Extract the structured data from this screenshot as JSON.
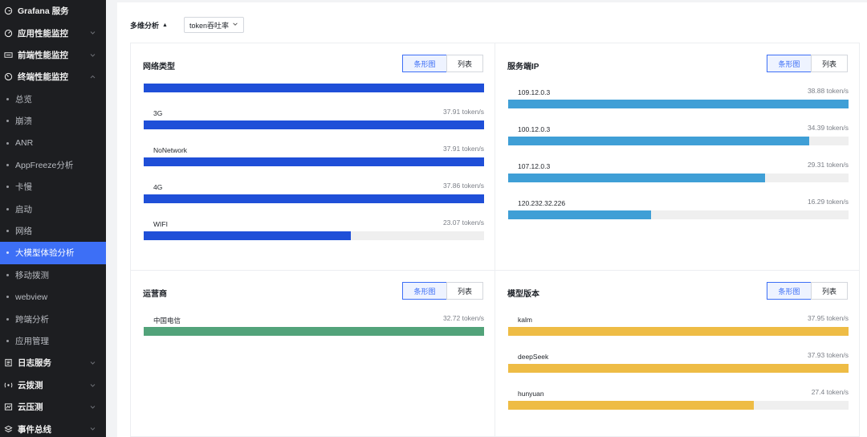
{
  "sidebar": {
    "items": [
      {
        "label": "Grafana 服务",
        "level": "top",
        "icon": "grafana-icon",
        "chevron": false
      },
      {
        "label": "应用性能监控",
        "level": "top",
        "icon": "gauge-icon",
        "chevron": true
      },
      {
        "label": "前端性能监控",
        "level": "top",
        "icon": "web-icon",
        "chevron": true
      },
      {
        "label": "终端性能监控",
        "level": "top",
        "icon": "terminal-gauge-icon",
        "chevron": true,
        "expanded": true
      },
      {
        "label": "总览",
        "level": "sub"
      },
      {
        "label": "崩溃",
        "level": "sub"
      },
      {
        "label": "ANR",
        "level": "sub"
      },
      {
        "label": "AppFreeze分析",
        "level": "sub"
      },
      {
        "label": "卡慢",
        "level": "sub"
      },
      {
        "label": "启动",
        "level": "sub"
      },
      {
        "label": "网络",
        "level": "sub"
      },
      {
        "label": "大模型体验分析",
        "level": "sub",
        "active": true
      },
      {
        "label": "移动拨测",
        "level": "sub"
      },
      {
        "label": "webview",
        "level": "sub"
      },
      {
        "label": "跨端分析",
        "level": "sub"
      },
      {
        "label": "应用管理",
        "level": "sub"
      },
      {
        "label": "日志服务",
        "level": "top",
        "icon": "log-icon",
        "chevron": true
      },
      {
        "label": "云拨测",
        "level": "top",
        "icon": "probe-icon",
        "chevron": true
      },
      {
        "label": "云压测",
        "level": "top",
        "icon": "stress-test-icon",
        "chevron": true
      },
      {
        "label": "事件总线",
        "level": "top",
        "icon": "event-bus-icon",
        "chevron": true
      }
    ]
  },
  "toolbar": {
    "dimension_label": "多维分析",
    "dimension_caret": "▲",
    "metric_value": "token吞吐率"
  },
  "toggle": {
    "bar_label": "条形图",
    "list_label": "列表"
  },
  "colors": {
    "network_type": "#1f4fd8",
    "server_ip": "#3f9fd6",
    "carrier": "#52a37a",
    "model_version": "#eebc45",
    "track": "#efefef",
    "accent": "#3d6ff6"
  },
  "panels": {
    "network_type": {
      "title": "网络类型",
      "rows": [
        {
          "label": "",
          "value": "",
          "ratio": 1.0
        },
        {
          "label": "3G",
          "value": "37.91 token/s",
          "ratio": 1.0
        },
        {
          "label": "NoNetwork",
          "value": "37.91 token/s",
          "ratio": 1.0
        },
        {
          "label": "4G",
          "value": "37.86 token/s",
          "ratio": 1.0
        },
        {
          "label": "WIFI",
          "value": "23.07 token/s",
          "ratio": 0.609
        }
      ]
    },
    "server_ip": {
      "title": "服务端IP",
      "rows": [
        {
          "label": "109.12.0.3",
          "value": "38.88 token/s",
          "ratio": 1.0
        },
        {
          "label": "100.12.0.3",
          "value": "34.39 token/s",
          "ratio": 0.885
        },
        {
          "label": "107.12.0.3",
          "value": "29.31 token/s",
          "ratio": 0.754
        },
        {
          "label": "120.232.32.226",
          "value": "16.29 token/s",
          "ratio": 0.419
        }
      ]
    },
    "carrier": {
      "title": "运营商",
      "rows": [
        {
          "label": "中国电信",
          "value": "32.72 token/s",
          "ratio": 1.0
        }
      ]
    },
    "model_version": {
      "title": "模型版本",
      "rows": [
        {
          "label": "kalm",
          "value": "37.95 token/s",
          "ratio": 1.0
        },
        {
          "label": "deepSeek",
          "value": "37.93 token/s",
          "ratio": 1.0
        },
        {
          "label": "hunyuan",
          "value": "27.4 token/s",
          "ratio": 0.722
        }
      ]
    }
  }
}
